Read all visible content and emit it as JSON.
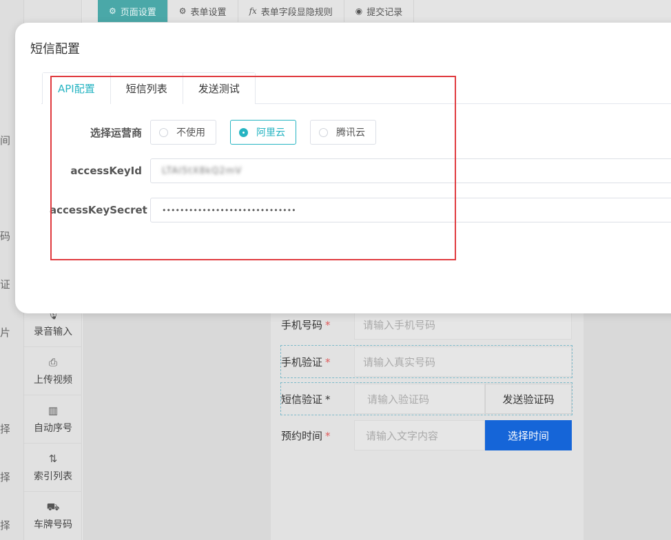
{
  "background": {
    "topbar": [
      {
        "icon": "⚙",
        "label": "页面设置",
        "active": true
      },
      {
        "icon": "⚙",
        "label": "表单设置"
      },
      {
        "icon": "fx",
        "label": "表单字段显隐规则"
      },
      {
        "icon": "◉",
        "label": "提交记录"
      }
    ],
    "left_fragments": [
      "间",
      "码",
      "证",
      "片",
      "择",
      "择",
      "择"
    ],
    "sidebar_tools": [
      {
        "icon": "🎙",
        "label": "录音输入"
      },
      {
        "icon": "⎙",
        "label": "上传视频"
      },
      {
        "icon": "▥",
        "label": "自动序号"
      },
      {
        "icon": "⇅",
        "label": "索引列表"
      },
      {
        "icon": "⛟",
        "label": "车牌号码"
      }
    ],
    "form": {
      "phone_label": "手机号码",
      "phone_placeholder": "请输入手机号码",
      "verify_label": "手机验证",
      "verify_placeholder": "请输入真实号码",
      "sms_label": "短信验证",
      "sms_placeholder": "请输入验证码",
      "sms_button": "发送验证码",
      "appointment_label": "预约时间",
      "appointment_placeholder": "请输入文字内容",
      "appointment_button": "选择时间",
      "required_mark": "*"
    }
  },
  "modal": {
    "title": "短信配置",
    "tabs": [
      "API配置",
      "短信列表",
      "发送测试"
    ],
    "active_tab": "API配置",
    "provider_label": "选择运营商",
    "providers": [
      "不使用",
      "阿里云",
      "腾讯云"
    ],
    "selected_provider": "阿里云",
    "access_key_id_label": "accessKeyId",
    "access_key_id_value": "LTAI5tX8kQ2mV",
    "access_key_secret_label": "accessKeySecret",
    "access_key_secret_value": "••••••••••••••••••••••••••••••"
  },
  "colors": {
    "accent": "#26b4c2",
    "highlight": "#e0393e",
    "primary_button": "#1565d8"
  }
}
